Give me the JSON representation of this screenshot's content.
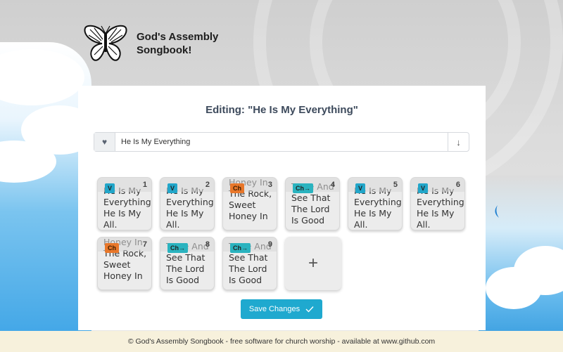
{
  "app": {
    "title": "God's Assembly Songbook!"
  },
  "editor": {
    "heading": "Editing: \"He Is My Everything\"",
    "song_name": "He Is My Everything",
    "save_label": "Save Changes",
    "add_label": "+"
  },
  "sections": [
    {
      "num": "1",
      "badge": "V",
      "kind": "v",
      "text": "He Is My Everything, He Is My All."
    },
    {
      "num": "2",
      "badge": "V",
      "kind": "v",
      "text": "He Is My Everything, He Is My All."
    },
    {
      "num": "3",
      "badge": "Ch",
      "kind": "ch",
      "text": "Honey In The Rock, Sweet Honey In"
    },
    {
      "num": "4",
      "badge": "Ch→",
      "kind": "cht",
      "text": "Taste And See That The Lord Is Good"
    },
    {
      "num": "5",
      "badge": "V",
      "kind": "v",
      "text": "He Is My Everything, He Is My All."
    },
    {
      "num": "6",
      "badge": "V",
      "kind": "v",
      "text": "He Is My Everything, He Is My All."
    },
    {
      "num": "7",
      "badge": "Ch",
      "kind": "ch",
      "text": "Honey In The Rock, Sweet Honey In"
    },
    {
      "num": "8",
      "badge": "Ch→",
      "kind": "cht",
      "text": "Taste And See That The Lord Is Good"
    },
    {
      "num": "9",
      "badge": "Ch→",
      "kind": "cht",
      "text": "Taste And See That The Lord Is Good"
    }
  ],
  "footer": {
    "text": "© God's Assembly Songbook - free software for church worship - available at www.github.com"
  },
  "icons": {
    "logo": "butterfly-icon",
    "favorite": "heart-icon",
    "menu": "arrow-down-icon",
    "save": "check-icon"
  },
  "colors": {
    "accent": "#1fa9cf",
    "verse_badge": "#22a6c9",
    "chorus_badge": "#e8772a",
    "footer_bg": "#f7f1dc"
  }
}
